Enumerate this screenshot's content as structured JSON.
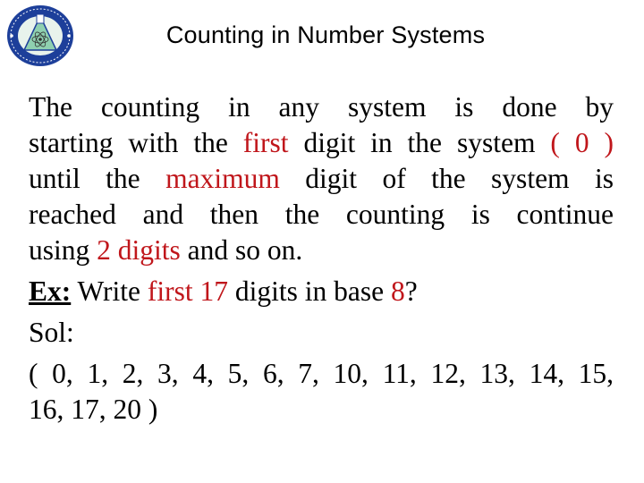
{
  "header": {
    "logo": "university-college-seal-logo",
    "title": "Counting in Number Systems"
  },
  "colors": {
    "text": "#000000",
    "highlight": "#c0161b",
    "logo_blue": "#1d3f9a"
  },
  "content": {
    "paragraph": {
      "line1": "The counting in any system is done by",
      "line2_a": "starting with the ",
      "line2_red1": "first",
      "line2_b": " digit in the system ",
      "line2_red2": "( 0 )",
      "line3_a": "until the ",
      "line3_red": "maximum",
      "line3_b": " digit of the system is",
      "line4": "reached and then the counting is continue",
      "line5_a": "using ",
      "line5_red": "2 digits",
      "line5_b": " and so on."
    },
    "example": {
      "label": "Ex:",
      "text_a": " Write ",
      "red1": "first 17",
      "text_b": " digits in base ",
      "red2": "8",
      "text_c": "?"
    },
    "solution": {
      "label": "Sol:",
      "line1": "( 0, 1, 2, 3, 4, 5, 6, 7, 10, 11, 12, 13, 14, 15,",
      "line2": "16, 17, 20 )"
    }
  }
}
